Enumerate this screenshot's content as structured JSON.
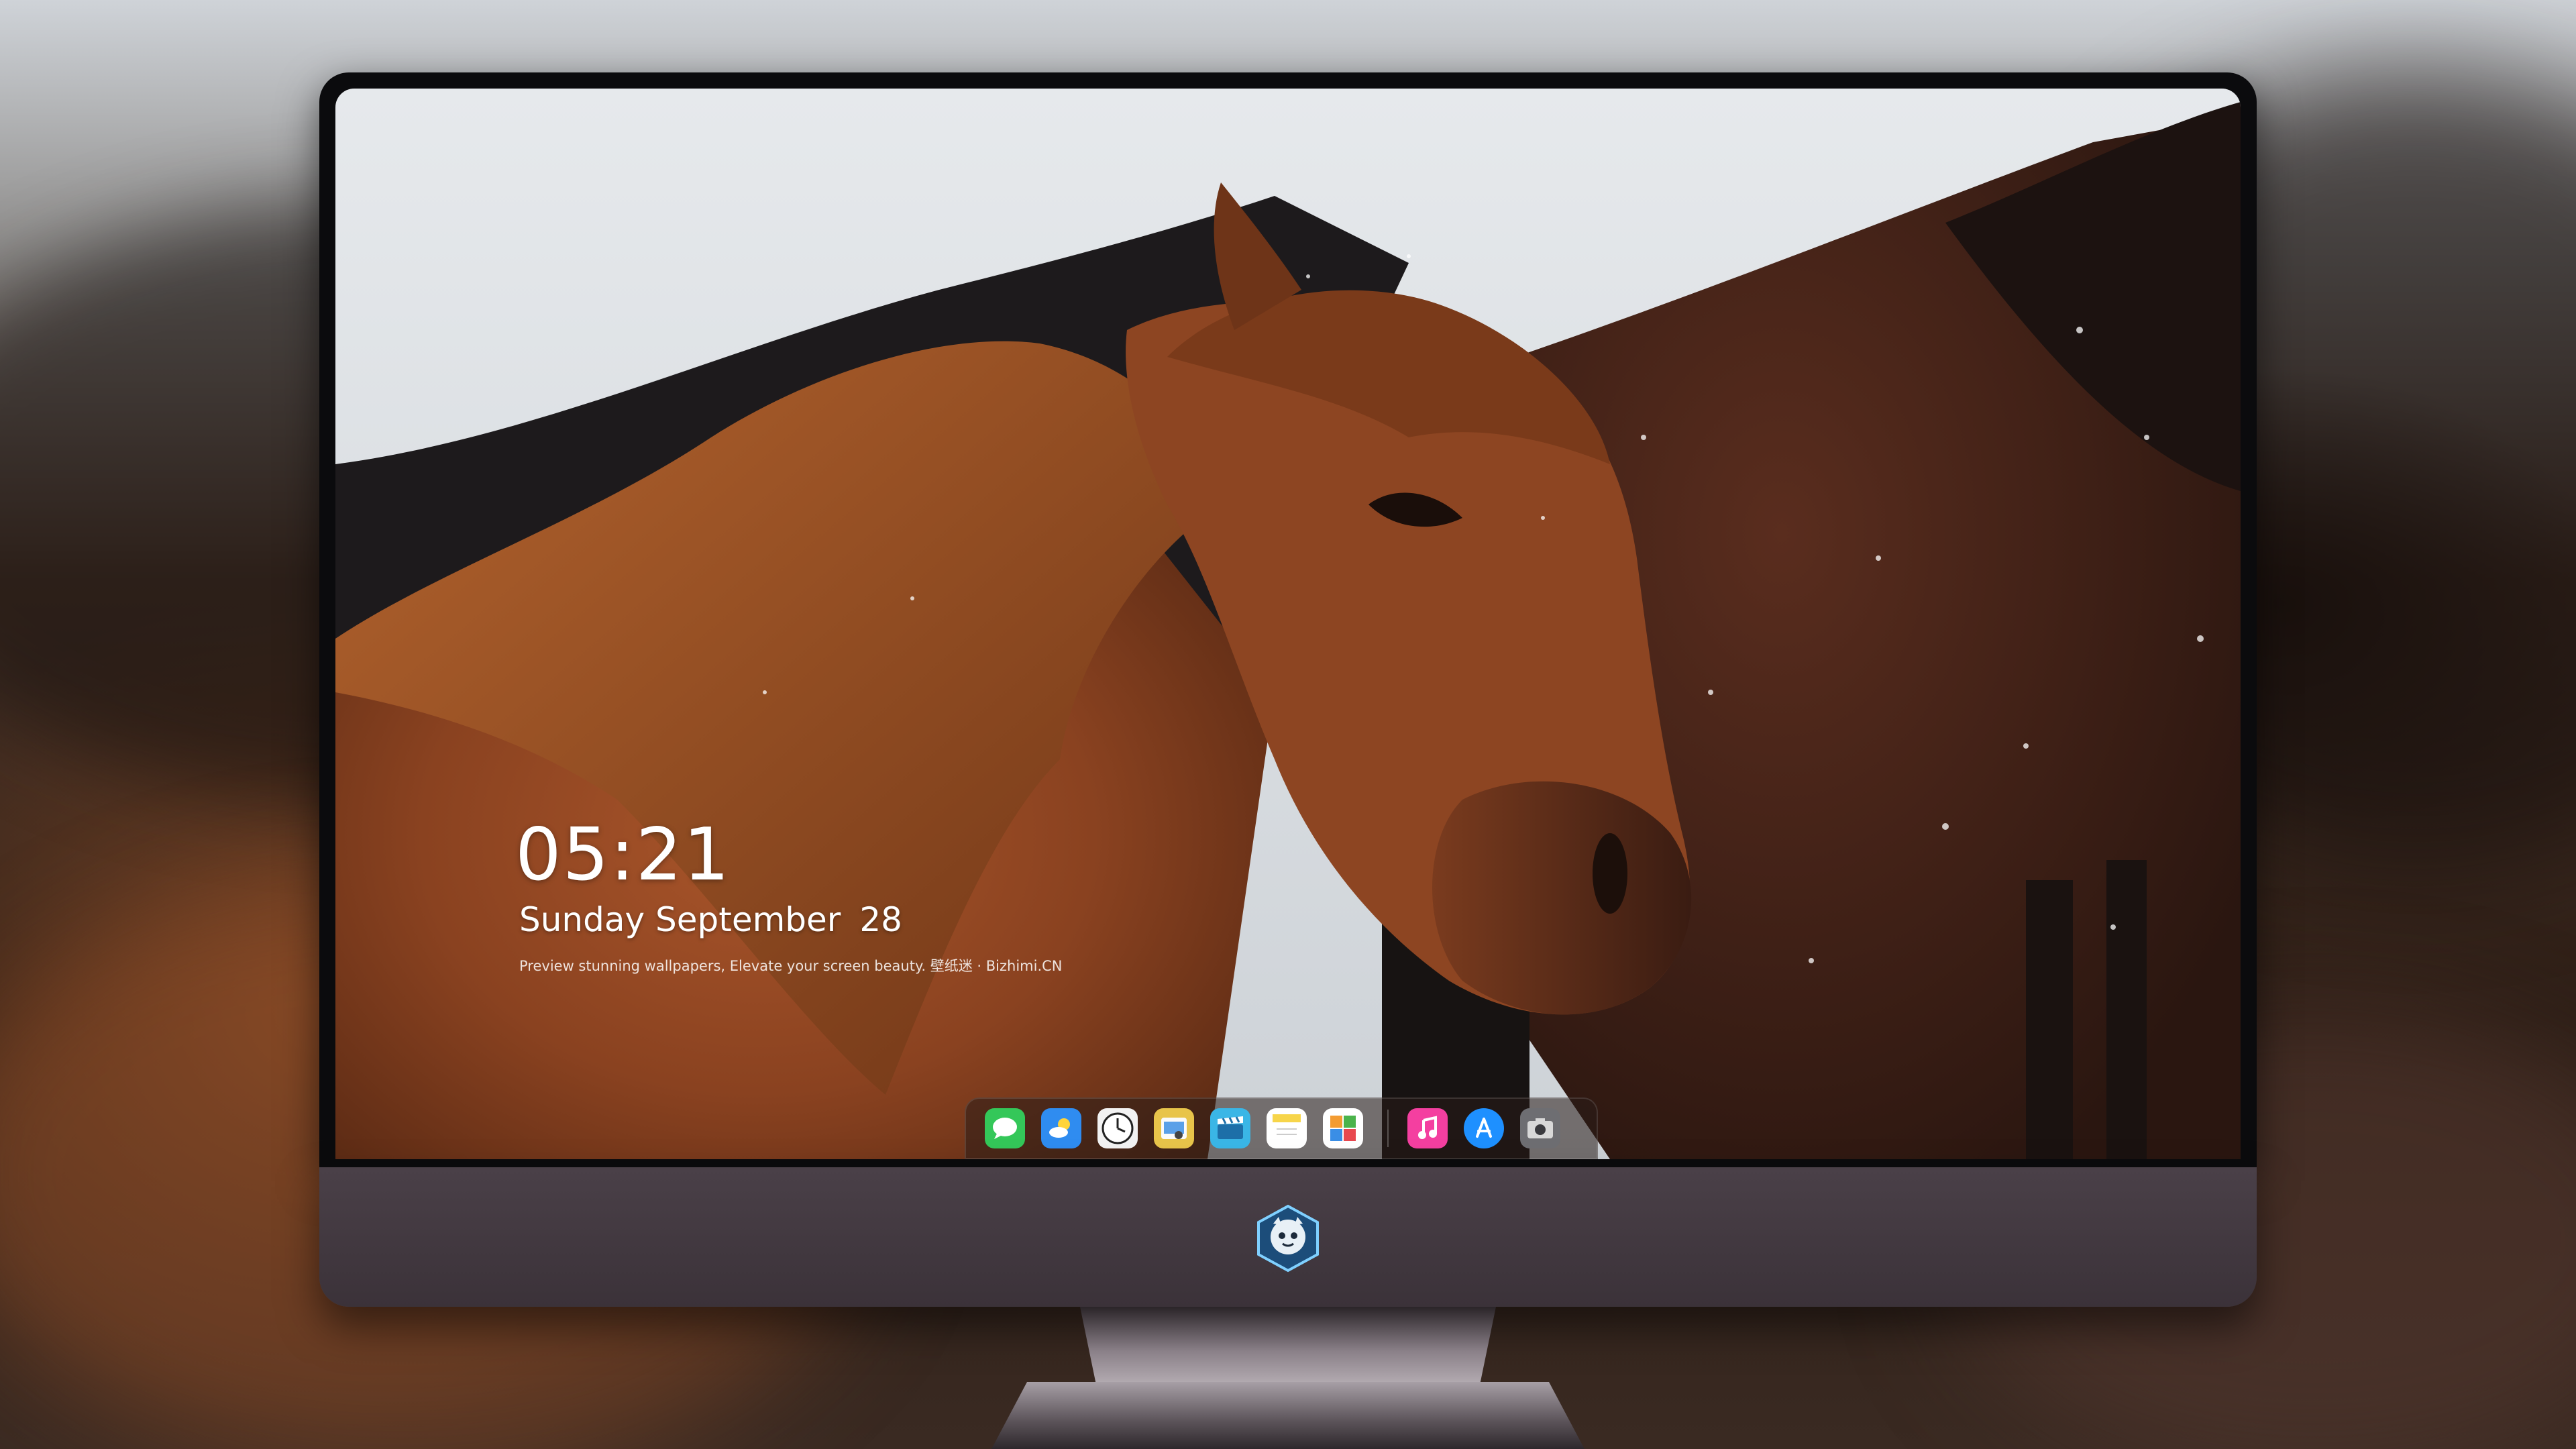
{
  "lockscreen": {
    "time": "05:21",
    "date_text": "Sunday September",
    "day": "28",
    "tagline": "Preview stunning wallpapers, Elevate your screen beauty. 壁纸迷 · Bizhimi.CN"
  },
  "dock": {
    "apps": [
      {
        "name": "messages",
        "icon": "messages-icon",
        "color": "#34c759"
      },
      {
        "name": "weather",
        "icon": "weather-icon",
        "color": "#2f8cf0"
      },
      {
        "name": "clock",
        "icon": "clock-icon",
        "color": "#f2f2f2"
      },
      {
        "name": "preview",
        "icon": "preview-icon",
        "color": "#e8c44a"
      },
      {
        "name": "claquette",
        "icon": "clapperboard-icon",
        "color": "#3ab6e6"
      },
      {
        "name": "notes",
        "icon": "notes-icon",
        "color": "#f7d54a"
      },
      {
        "name": "photo-booth",
        "icon": "photos-grid-icon",
        "color": "#f39c32"
      }
    ],
    "pinned": [
      {
        "name": "music",
        "icon": "music-icon",
        "color": "#f43fa0"
      },
      {
        "name": "app-store",
        "icon": "app-store-icon",
        "color": "#1e90ff"
      },
      {
        "name": "camera",
        "icon": "camera-icon",
        "color": "#6e6e72"
      }
    ]
  },
  "monitor": {
    "logo": "mascot-logo-icon",
    "bezel_color": "#0b0b0d",
    "chin_color": "#433a41"
  }
}
